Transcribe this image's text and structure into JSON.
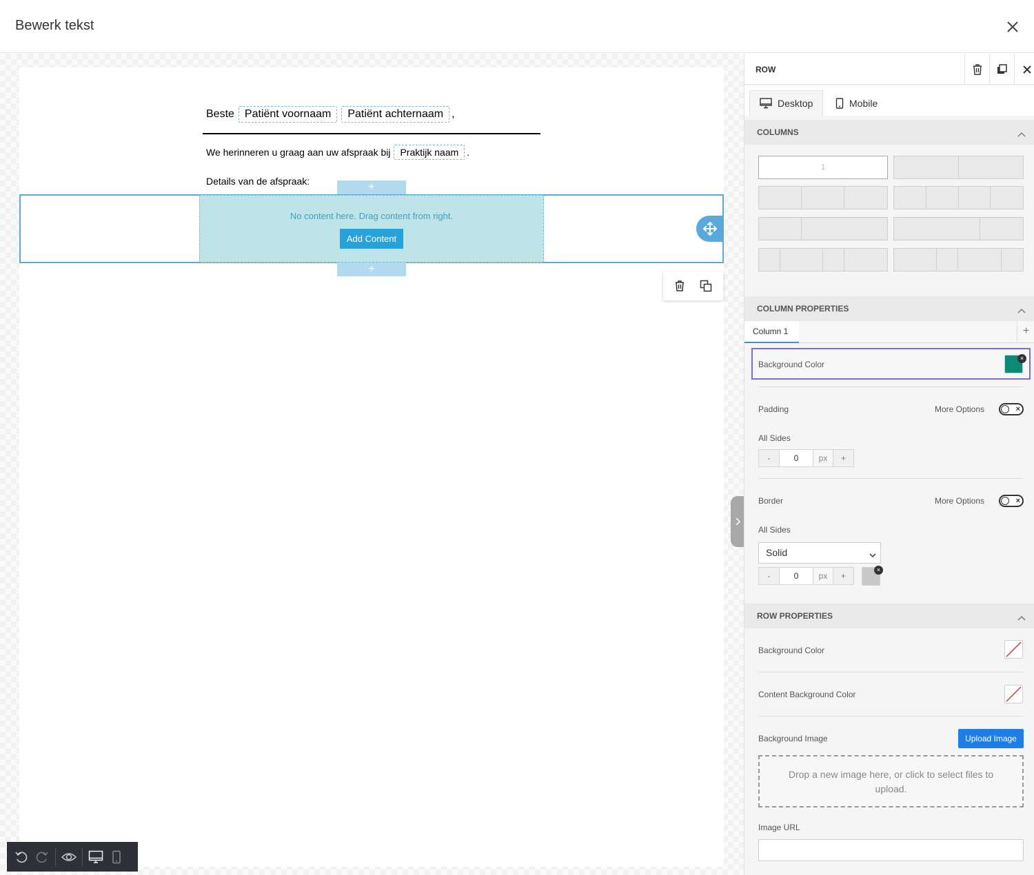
{
  "header": {
    "title": "Bewerk tekst"
  },
  "email": {
    "greeting": "Beste",
    "tag_firstname": "Patiënt voornaam",
    "tag_lastname": "Patiënt achternaam",
    "comma": ",",
    "reminder": "We herinneren u graag aan uw afspraak bij",
    "tag_practice": "Praktijk naam",
    "period": ".",
    "details": "Details van de afspraak:"
  },
  "empty_column": {
    "message": "No content here. Drag content from right.",
    "add_button": "Add Content"
  },
  "add_tab_symbol": "+",
  "panel": {
    "title": "ROW",
    "tabs": {
      "desktop": "Desktop",
      "mobile": "Mobile"
    },
    "columns": {
      "title": "COLUMNS",
      "selected_label": "1"
    },
    "column_properties": {
      "title": "COLUMN PROPERTIES",
      "tab": "Column 1",
      "add": "+",
      "background_color_label": "Background Color",
      "background_color": "#0d8a74",
      "padding_label": "Padding",
      "more_options": "More Options",
      "all_sides": "All Sides",
      "padding_value": "0",
      "unit": "px",
      "minus": "-",
      "plus": "+",
      "border_label": "Border",
      "border_style": "Solid",
      "border_width": "0",
      "border_color": "#c8c8c8"
    },
    "row_properties": {
      "title": "ROW PROPERTIES",
      "background_color_label": "Background Color",
      "content_background_color_label": "Content Background Color",
      "background_image_label": "Background Image",
      "upload_button": "Upload Image",
      "dropzone_text": "Drop a new image here, or click to select files to upload.",
      "image_url_label": "Image URL",
      "image_url_value": ""
    }
  },
  "colors": {
    "accent": "#26a3da",
    "selection": "#5aa9dd",
    "highlight": "#7e6bdc",
    "toolbar": "#2e3238"
  }
}
